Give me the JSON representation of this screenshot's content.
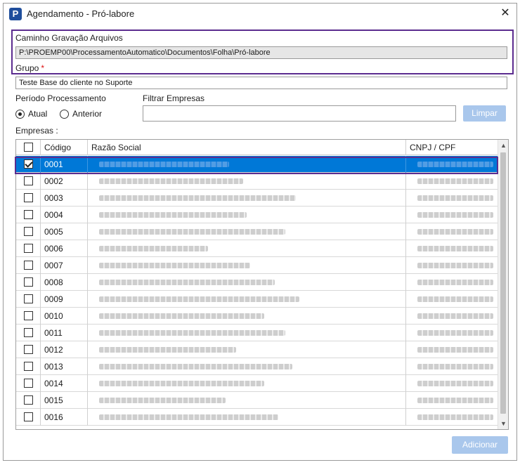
{
  "window": {
    "title": "Agendamento - Pró-labore",
    "app_icon": "P",
    "close_glyph": "✕"
  },
  "caminho": {
    "label": "Caminho Gravação Arquivos",
    "value": "P:\\PROEMP00\\ProcessamentoAutomatico\\Documentos\\Folha\\Pró-labore"
  },
  "grupo": {
    "label": "Grupo",
    "required_mark": "*",
    "value": "Teste Base do cliente no Suporte"
  },
  "periodo": {
    "label": "Período Processamento",
    "options": [
      {
        "label": "Atual",
        "selected": true
      },
      {
        "label": "Anterior",
        "selected": false
      }
    ]
  },
  "filtro": {
    "label": "Filtrar Empresas",
    "value": "",
    "clear_button": "Limpar"
  },
  "empresas": {
    "label": "Empresas :",
    "columns": {
      "codigo": "Código",
      "razao": "Razão Social",
      "cnpj": "CNPJ / CPF"
    },
    "rows": [
      {
        "code": "0001",
        "checked": true,
        "selected": true
      },
      {
        "code": "0002",
        "checked": false,
        "selected": false
      },
      {
        "code": "0003",
        "checked": false,
        "selected": false
      },
      {
        "code": "0004",
        "checked": false,
        "selected": false
      },
      {
        "code": "0005",
        "checked": false,
        "selected": false
      },
      {
        "code": "0006",
        "checked": false,
        "selected": false
      },
      {
        "code": "0007",
        "checked": false,
        "selected": false
      },
      {
        "code": "0008",
        "checked": false,
        "selected": false
      },
      {
        "code": "0009",
        "checked": false,
        "selected": false
      },
      {
        "code": "0010",
        "checked": false,
        "selected": false
      },
      {
        "code": "0011",
        "checked": false,
        "selected": false
      },
      {
        "code": "0012",
        "checked": false,
        "selected": false
      },
      {
        "code": "0013",
        "checked": false,
        "selected": false
      },
      {
        "code": "0014",
        "checked": false,
        "selected": false
      },
      {
        "code": "0015",
        "checked": false,
        "selected": false
      },
      {
        "code": "0016",
        "checked": false,
        "selected": false
      }
    ]
  },
  "footer": {
    "add_button": "Adicionar"
  },
  "colors": {
    "accent": "#0078d7",
    "highlight_border": "#5b2c8f",
    "button_bg": "#a9c7ec",
    "required": "#dd1111"
  }
}
